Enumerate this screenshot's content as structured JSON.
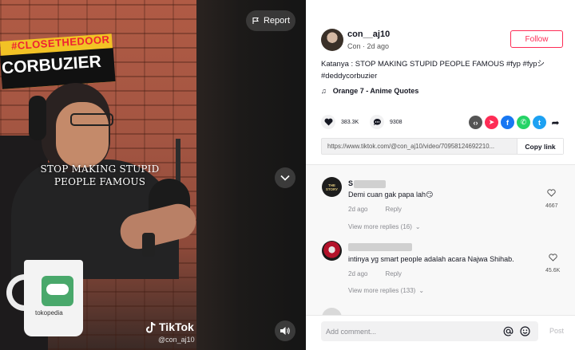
{
  "video": {
    "sign_hashtag": "#CLOSETHEDOOR",
    "sign_name": "CORBUZIER",
    "caption_line1": "STOP MAKING STUPID",
    "caption_line2": "PEOPLE FAMOUS",
    "mug_brand": "tokopedia",
    "report_label": "Report",
    "watermark_brand": "TikTok",
    "watermark_user": "@con_aj10"
  },
  "author": {
    "username": "con__aj10",
    "meta": "Con · 2d ago",
    "follow_label": "Follow"
  },
  "description": {
    "text": "Katanya : STOP MAKING STUPID PEOPLE FAMOUS #fyp #fypシ #deddycorbuzier",
    "music": "Orange 7 - Anime Quotes"
  },
  "stats": {
    "likes": "383.3K",
    "comments": "9308"
  },
  "share": {
    "icons": [
      "embed-icon",
      "send-icon",
      "facebook-icon",
      "whatsapp-icon",
      "twitter-icon",
      "share-arrow-icon"
    ],
    "colors": {
      "embed": "#555555",
      "send": "#fe2c55",
      "facebook": "#1877f2",
      "whatsapp": "#25d366",
      "twitter": "#1da1f2"
    }
  },
  "link": {
    "url": "https://www.tiktok.com/@con_aj10/video/70958124692210...",
    "copy_label": "Copy link"
  },
  "comments": [
    {
      "name": "S",
      "text": "Demi cuan gak papa lah😏",
      "time": "2d ago",
      "reply_label": "Reply",
      "likes": "4667",
      "view_replies": "View more replies (16)",
      "avatar_label": "THE STORY"
    },
    {
      "name": "",
      "text": "intinya yg smart people adalah acara Najwa Shihab.",
      "time": "2d ago",
      "reply_label": "Reply",
      "likes": "45.6K",
      "view_replies": "View more replies (133)"
    }
  ],
  "add_comment": {
    "placeholder": "Add comment...",
    "post_label": "Post"
  }
}
